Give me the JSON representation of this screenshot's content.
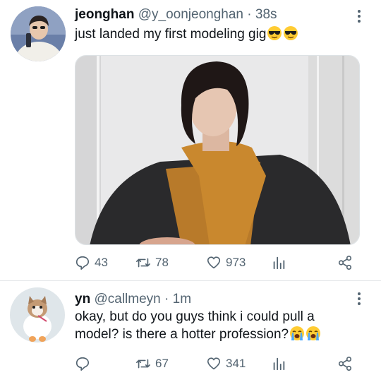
{
  "tweets": [
    {
      "name": "jeonghan",
      "handle": "@y_oonjeonghan",
      "separator": "·",
      "time": "38s",
      "text": "just landed my first modeling gig",
      "emoji": [
        "smiling-face-with-sunglasses",
        "smiling-face-with-sunglasses"
      ],
      "replies": "43",
      "retweets": "78",
      "likes": "973"
    },
    {
      "name": "yn",
      "handle": "@callmeyn",
      "separator": "·",
      "time": "1m",
      "text": "okay, but do you guys think i could pull a model? is there a hotter profession?",
      "emoji": [
        "loudly-crying-face",
        "loudly-crying-face"
      ],
      "replies": "",
      "retweets": "67",
      "likes": "341"
    }
  ],
  "icons": {
    "reply": "reply-icon",
    "retweet": "retweet-icon",
    "like": "heart-icon",
    "stats": "stats-icon",
    "share": "share-icon",
    "more": "more-options-icon"
  },
  "colors": {
    "text": "#0f1419",
    "secondary": "#536471",
    "divider": "#e3e6e8",
    "emoji": "#ffcc33"
  }
}
